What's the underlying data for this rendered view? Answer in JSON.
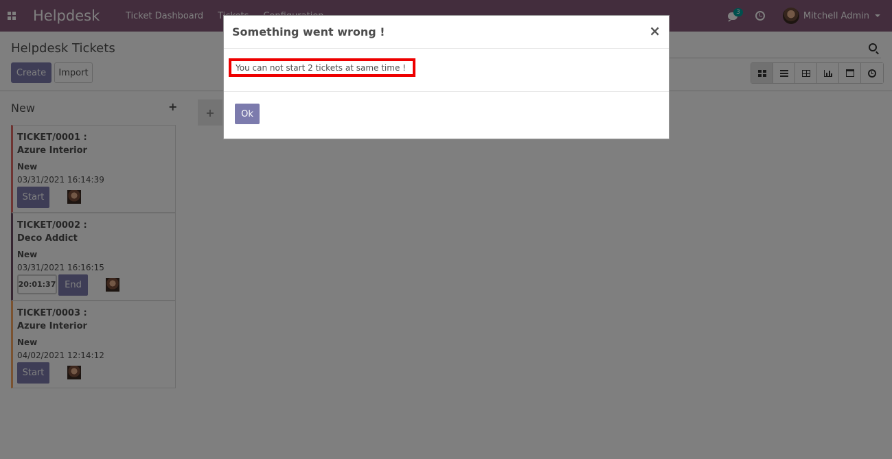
{
  "navbar": {
    "app_name": "Helpdesk",
    "menu": [
      "Ticket Dashboard",
      "Tickets",
      "Configuration"
    ],
    "chat_badge": "3",
    "user_name": "Mitchell Admin"
  },
  "control_panel": {
    "title": "Helpdesk Tickets",
    "create_label": "Create",
    "import_label": "Import"
  },
  "kanban": {
    "column_title": "New",
    "add_column_symbol": "+",
    "column_add_symbol": "+",
    "cards": [
      {
        "ref": "TICKET/0001 :",
        "customer": "Azure Interior",
        "stage": "New",
        "date": "03/31/2021 16:14:39",
        "action": "Start",
        "timer": "",
        "color": "#dc6965"
      },
      {
        "ref": "TICKET/0002 :",
        "customer": "Deco Addict",
        "stage": "New",
        "date": "03/31/2021 16:16:15",
        "action": "End",
        "timer": "20:01:37",
        "color": "#6c4b62"
      },
      {
        "ref": "TICKET/0003 :",
        "customer": "Azure Interior",
        "stage": "New",
        "date": "04/02/2021 12:14:12",
        "action": "Start",
        "timer": "",
        "color": "#f4a460"
      }
    ]
  },
  "dialog": {
    "title": "Something went wrong !",
    "close_symbol": "×",
    "message": "You can not start 2 tickets at same time !",
    "ok_label": "Ok"
  },
  "colors": {
    "navbar": "#875a7b",
    "primary": "#7c7bad",
    "highlight_border": "#ee0000"
  }
}
